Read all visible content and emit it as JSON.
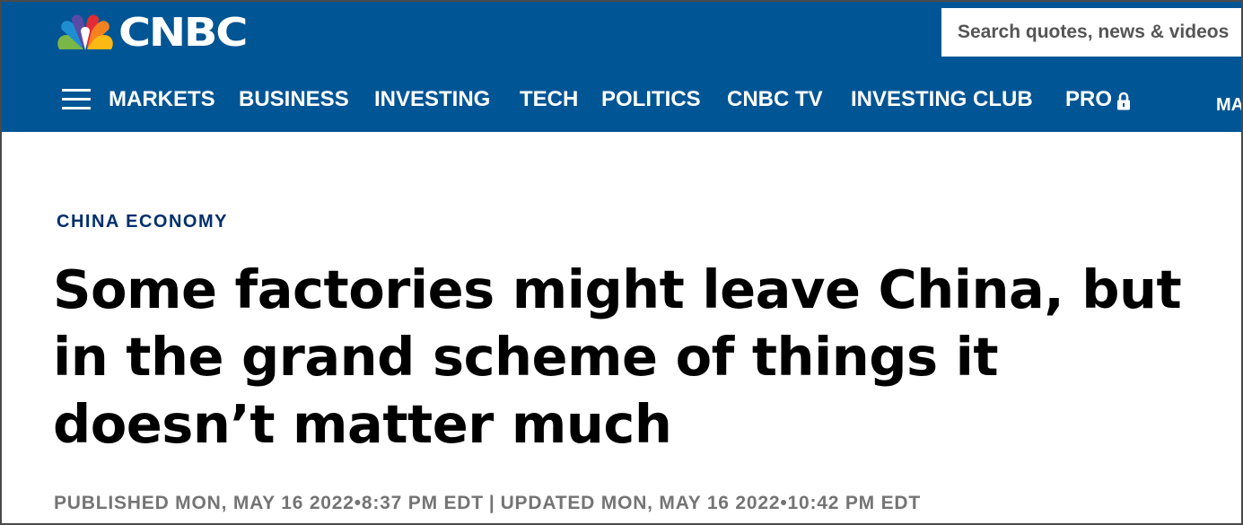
{
  "header": {
    "brand": "CNBC",
    "brand_color": "#005594",
    "search_placeholder": "Search quotes, news & videos"
  },
  "nav": {
    "items": [
      "MARKETS",
      "BUSINESS",
      "INVESTING",
      "TECH",
      "POLITICS",
      "CNBC TV",
      "INVESTING CLUB",
      "PRO",
      "MA"
    ]
  },
  "article": {
    "eyebrow": "CHINA ECONOMY",
    "eyebrow_color": "#002f6c",
    "headline": "Some factories might leave China, but in the grand scheme of things it doesn’t matter much",
    "published": "PUBLISHED MON, MAY 16 2022•8:37 PM EDT",
    "separator": "|",
    "updated": "UPDATED MON, MAY 16 2022•10:42 PM EDT"
  },
  "icons": {
    "logo": "nbc-peacock-icon",
    "menu": "hamburger-menu-icon",
    "pro_lock": "lock-icon"
  }
}
